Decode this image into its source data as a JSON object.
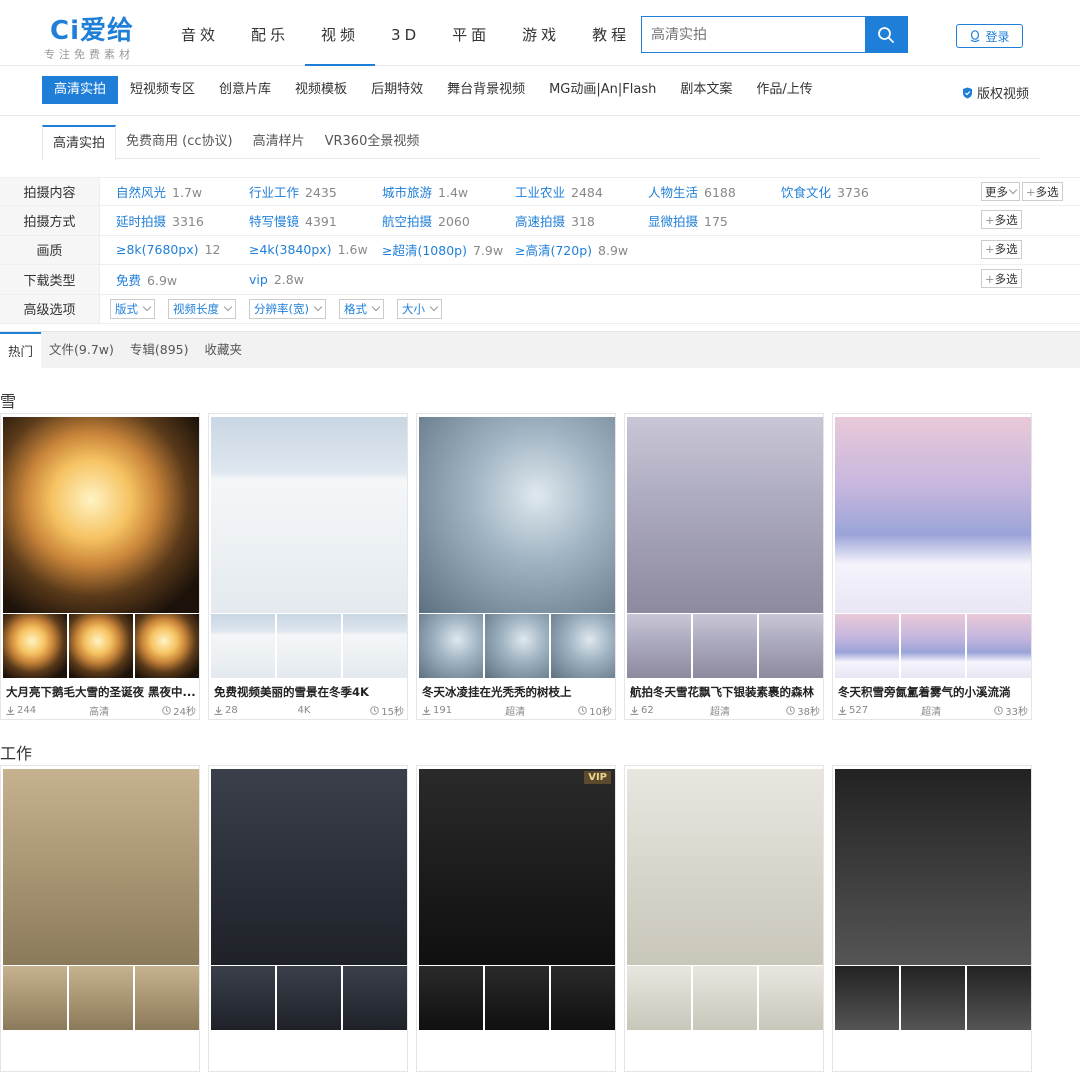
{
  "header": {
    "logo_main": "Ci爱给",
    "logo_sub": "专注免费素材",
    "nav": [
      "音效",
      "配乐",
      "视频",
      "3D",
      "平面",
      "游戏",
      "教程"
    ],
    "nav_active": 2,
    "search_placeholder": "高清实拍",
    "login_label": "登录"
  },
  "subnav": {
    "items": [
      "高清实拍",
      "短视频专区",
      "创意片库",
      "视频模板",
      "后期特效",
      "舞台背景视频",
      "MG动画|An|Flash",
      "剧本文案",
      "作品/上传"
    ],
    "copyright_label": "版权视频"
  },
  "category_tabs": [
    "高清实拍",
    "免费商用 (cc协议)",
    "高清样片",
    "VR360全景视频"
  ],
  "filters": [
    {
      "label": "拍摄内容",
      "options": [
        {
          "t": "自然风光",
          "c": "1.7w"
        },
        {
          "t": "行业工作",
          "c": "2435"
        },
        {
          "t": "城市旅游",
          "c": "1.4w"
        },
        {
          "t": "工业农业",
          "c": "2484"
        },
        {
          "t": "人物生活",
          "c": "6188"
        },
        {
          "t": "饮食文化",
          "c": "3736"
        }
      ],
      "more": "更多",
      "multi": "多选"
    },
    {
      "label": "拍摄方式",
      "options": [
        {
          "t": "延时拍摄",
          "c": "3316"
        },
        {
          "t": "特写慢镜",
          "c": "4391"
        },
        {
          "t": "航空拍摄",
          "c": "2060"
        },
        {
          "t": "高速拍摄",
          "c": "318"
        },
        {
          "t": "显微拍摄",
          "c": "175"
        }
      ],
      "multi": "多选"
    },
    {
      "label": "画质",
      "options": [
        {
          "t": "≥8k(7680px)",
          "c": "12"
        },
        {
          "t": "≥4k(3840px)",
          "c": "1.6w"
        },
        {
          "t": "≥超清(1080p)",
          "c": "7.9w"
        },
        {
          "t": "≥高清(720p)",
          "c": "8.9w"
        }
      ],
      "multi": "多选"
    },
    {
      "label": "下载类型",
      "options": [
        {
          "t": "免费",
          "c": "6.9w"
        },
        {
          "t": "vip",
          "c": "2.8w"
        }
      ],
      "multi": "多选"
    }
  ],
  "advanced": {
    "label": "高级选项",
    "selects": [
      "版式",
      "视频长度",
      "分辨率(宽)",
      "格式",
      "大小"
    ]
  },
  "result_tabs": [
    "热门",
    "文件(9.7w)",
    "专辑(895)",
    "收藏夹"
  ],
  "sections": [
    {
      "title": "雪",
      "cards": [
        {
          "title": "大月亮下鹅毛大雪的圣诞夜 黑夜中...",
          "downloads": "244",
          "quality": "高清",
          "duration": "24秒",
          "bg": "c1bg"
        },
        {
          "title": "免费视频美丽的雪景在冬季4K",
          "downloads": "28",
          "quality": "4K",
          "duration": "15秒",
          "bg": "c2bg"
        },
        {
          "title": "冬天冰凌挂在光秃秃的树枝上",
          "downloads": "191",
          "quality": "超清",
          "duration": "10秒",
          "bg": "c3bg"
        },
        {
          "title": "航拍冬天雪花飘飞下银装素裹的森林",
          "downloads": "62",
          "quality": "超清",
          "duration": "38秒",
          "bg": "c4bg"
        },
        {
          "title": "冬天积雪旁氤氲着雾气的小溪流淌",
          "downloads": "527",
          "quality": "超清",
          "duration": "33秒",
          "bg": "c5bg"
        }
      ]
    },
    {
      "title": "工作",
      "cards": [
        {
          "bg": "c6bg"
        },
        {
          "bg": "c7bg"
        },
        {
          "bg": "c8bg",
          "vip": "VIP"
        },
        {
          "bg": "c9bg"
        },
        {
          "bg": "c10bg"
        }
      ]
    }
  ],
  "colors": {
    "accent": "#1f7fd8"
  }
}
